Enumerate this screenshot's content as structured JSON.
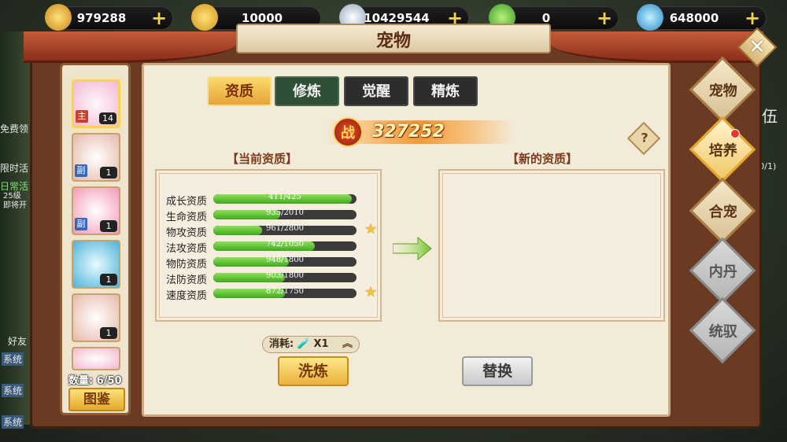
{
  "currencies": [
    {
      "icon": "gold-ingot-icon",
      "value": "979288",
      "color": "#f2c23a"
    },
    {
      "icon": "gold-treasure-icon",
      "value": "10000",
      "color": "#f5b51f"
    },
    {
      "icon": "silver-ingot-icon",
      "value": "10429544",
      "color": "#c8d6e6"
    },
    {
      "icon": "jade-coin-icon",
      "value": "0",
      "color": "#4caf3a"
    },
    {
      "icon": "blue-token-icon",
      "value": "648000",
      "color": "#3aa3d8"
    }
  ],
  "window": {
    "title": "宠物"
  },
  "tabs": [
    {
      "label": "资质",
      "active": true
    },
    {
      "label": "修炼",
      "active": false
    },
    {
      "label": "觉醒",
      "active": false
    },
    {
      "label": "精炼",
      "active": false
    }
  ],
  "power": {
    "icon_text": "战",
    "value": "327252"
  },
  "sections": {
    "current": "【当前资质】",
    "new": "【新的资质】"
  },
  "stats": [
    {
      "label": "成长资质",
      "text": "411/425",
      "fraction": 0.967,
      "star": false
    },
    {
      "label": "生命资质",
      "text": "935/2010",
      "fraction": 0.465,
      "star": false
    },
    {
      "label": "物攻资质",
      "text": "961/2800",
      "fraction": 0.343,
      "star": true
    },
    {
      "label": "法攻资质",
      "text": "742/1050",
      "fraction": 0.707,
      "star": false
    },
    {
      "label": "物防资质",
      "text": "948/1800",
      "fraction": 0.527,
      "star": false
    },
    {
      "label": "法防资质",
      "text": "903/1800",
      "fraction": 0.502,
      "star": false
    },
    {
      "label": "速度资质",
      "text": "872/1750",
      "fraction": 0.498,
      "star": true
    }
  ],
  "cost": {
    "label": "消耗:",
    "qty": "X1"
  },
  "buttons": {
    "wash": "洗炼",
    "replace": "替换",
    "atlas": "图鉴",
    "help": "?"
  },
  "pets": [
    {
      "tag": "主",
      "level": "14",
      "selected": true,
      "color": "#f7d8e8"
    },
    {
      "tag": "副",
      "level": "1",
      "selected": false,
      "color": "#e9c7b7"
    },
    {
      "tag": "副",
      "level": "1",
      "selected": false,
      "color": "#f3b7c9"
    },
    {
      "tag": "",
      "level": "1",
      "selected": false,
      "color": "#8fd1e6"
    },
    {
      "tag": "",
      "level": "1",
      "selected": false,
      "color": "#e9c7b7"
    },
    {
      "tag": "",
      "level": "",
      "selected": false,
      "color": "#f3c2d6"
    }
  ],
  "pet_count": "数量: 6/50",
  "nav": [
    {
      "label": "宠物",
      "state": "normal"
    },
    {
      "label": "培养",
      "state": "active"
    },
    {
      "label": "合宠",
      "state": "normal"
    },
    {
      "label": "内丹",
      "state": "dim"
    },
    {
      "label": "统驭",
      "state": "dim"
    }
  ],
  "background_texts": [
    "免费领",
    "限时活",
    "日常活",
    "25级",
    "即将开",
    "伍",
    "(0/1)",
    "好友",
    "系统",
    "系统",
    "系统"
  ]
}
